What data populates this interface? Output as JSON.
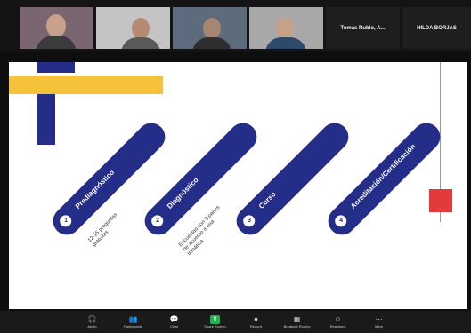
{
  "gallery": {
    "participants": [
      {
        "id": "p1",
        "name": "",
        "bg": "#7a6670",
        "skin": "#c9a08b",
        "shirt": "#3c3c3c"
      },
      {
        "id": "p2",
        "name": "",
        "bg": "#c4c4c4",
        "skin": "#b58b72",
        "shirt": "#5a5a5a"
      },
      {
        "id": "p3",
        "name": "",
        "bg": "#5d6b7c",
        "skin": "#a58673",
        "shirt": "#2f2f2f"
      },
      {
        "id": "p4",
        "name": "",
        "bg": "#a8a8a8",
        "skin": "#c5a18a",
        "shirt": "#2e4a6a"
      }
    ],
    "name_tiles": [
      "Tomás Rubio, A...",
      "HILDA BORJAS"
    ]
  },
  "slide": {
    "colors": {
      "navy": "#242e88",
      "yellow": "#f6c23a",
      "red": "#e33b3b",
      "line": "#9a9a9a"
    },
    "steps": [
      {
        "num": "1",
        "label": "Prediagnóstico",
        "sub": [
          "12-15 preguntas",
          "gratuitas"
        ]
      },
      {
        "num": "2",
        "label": "Diagnóstico",
        "sub": [
          "Encuestas con 3 partes",
          "de acuerdo a una",
          "temática"
        ]
      },
      {
        "num": "3",
        "label": "Curso",
        "sub": []
      },
      {
        "num": "4",
        "label": "Acreditación/Certificación",
        "sub": []
      }
    ]
  },
  "toolbar": {
    "buttons": [
      {
        "key": "audio",
        "icon": "🎧",
        "label": "Audio"
      },
      {
        "key": "participants",
        "icon": "👥",
        "label": "Participants"
      },
      {
        "key": "chat",
        "icon": "💬",
        "label": "Chat"
      },
      {
        "key": "share",
        "icon": "⬆",
        "label": "Share Screen"
      },
      {
        "key": "record",
        "icon": "⏺",
        "label": "Record"
      },
      {
        "key": "rooms",
        "icon": "▦",
        "label": "Breakout Rooms"
      },
      {
        "key": "reactions",
        "icon": "☺",
        "label": "Reactions"
      },
      {
        "key": "more",
        "icon": "⋯",
        "label": "More"
      }
    ]
  }
}
